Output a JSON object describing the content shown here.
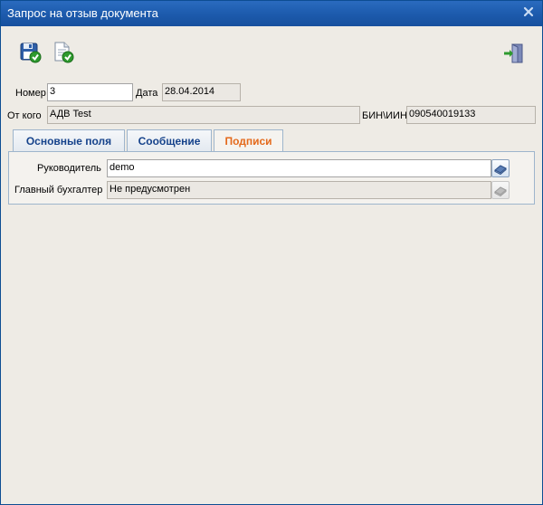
{
  "window": {
    "title": "Запрос на отзыв документа"
  },
  "toolbar": {
    "save_icon": "save-sign-icon",
    "sign_icon": "document-sign-icon",
    "exit_icon": "exit-door-icon"
  },
  "form": {
    "number_label": "Номер",
    "number_value": "3",
    "date_label": "Дата",
    "date_value": "28.04.2014",
    "from_label": "От кого",
    "from_value": "АДВ Test",
    "bin_label": "БИН\\ИИН",
    "bin_value": "090540019133"
  },
  "tabs": [
    {
      "label": "Основные поля",
      "active": false
    },
    {
      "label": "Сообщение",
      "active": false
    },
    {
      "label": "Подписи",
      "active": true
    }
  ],
  "signatures": {
    "head_label": "Руководитель",
    "head_value": "demo",
    "accountant_label": "Главный бухгалтер",
    "accountant_value": "Не предусмотрен"
  },
  "colors": {
    "titlebar": "#1c5aac",
    "active_tab_text": "#e46a1c",
    "tab_text": "#15428b",
    "window_bg": "#eeebe5"
  }
}
